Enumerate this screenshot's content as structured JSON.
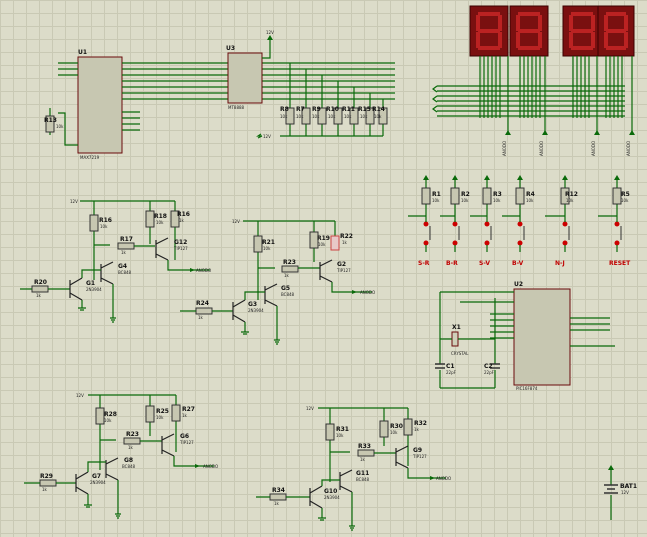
{
  "chips": {
    "u1": {
      "ref": "U1",
      "part": "MAX7219"
    },
    "u3": {
      "ref": "U3",
      "part": "MT8888"
    },
    "u2": {
      "ref": "U2",
      "part": "PIC16F874"
    }
  },
  "transistors": [
    {
      "ref": "G1",
      "part": "2N3904"
    },
    {
      "ref": "G4",
      "part": "BC848"
    },
    {
      "ref": "G12",
      "part": "TIP127"
    },
    {
      "ref": "G3",
      "part": "2N3904"
    },
    {
      "ref": "G5",
      "part": "BC848"
    },
    {
      "ref": "G2",
      "part": "TIP127"
    },
    {
      "ref": "G7",
      "part": "2N3904"
    },
    {
      "ref": "G8",
      "part": "BC848"
    },
    {
      "ref": "G6",
      "part": "TIP127"
    },
    {
      "ref": "G10",
      "part": "2N3904"
    },
    {
      "ref": "G11",
      "part": "BC848"
    },
    {
      "ref": "G9",
      "part": "TIP127"
    }
  ],
  "resistors": {
    "r13": {
      "ref": "R13",
      "val": "10k"
    },
    "row": [
      {
        "ref": "R8",
        "val": "10k"
      },
      {
        "ref": "R7",
        "val": "10k"
      },
      {
        "ref": "R9",
        "val": "10k"
      },
      {
        "ref": "R10",
        "val": "10k"
      },
      {
        "ref": "R11",
        "val": "10k"
      },
      {
        "ref": "R15",
        "val": "10k"
      },
      {
        "ref": "R14",
        "val": "10k"
      }
    ],
    "pullups": [
      {
        "ref": "R1",
        "val": "10k"
      },
      {
        "ref": "R2",
        "val": "10k"
      },
      {
        "ref": "R3",
        "val": "10k"
      },
      {
        "ref": "R4",
        "val": "10k"
      },
      {
        "ref": "R12",
        "val": "10k"
      },
      {
        "ref": "R5",
        "val": "10k"
      }
    ],
    "d1": [
      {
        "ref": "R16",
        "val": "10k"
      },
      {
        "ref": "R18",
        "val": "10k"
      },
      {
        "ref": "R16",
        "val": "1k"
      },
      {
        "ref": "R17",
        "val": "1k"
      },
      {
        "ref": "R20",
        "val": "1k"
      }
    ],
    "d2": [
      {
        "ref": "R21",
        "val": "10k"
      },
      {
        "ref": "R19",
        "val": "10k"
      },
      {
        "ref": "R22",
        "val": "1k"
      },
      {
        "ref": "R23",
        "val": "1k"
      },
      {
        "ref": "R24",
        "val": "1k"
      }
    ],
    "d3": [
      {
        "ref": "R28",
        "val": "10k"
      },
      {
        "ref": "R25",
        "val": "10k"
      },
      {
        "ref": "R27",
        "val": "1k"
      },
      {
        "ref": "R23",
        "val": "1k"
      },
      {
        "ref": "R29",
        "val": "1k"
      }
    ],
    "d4": [
      {
        "ref": "R31",
        "val": "10k"
      },
      {
        "ref": "R30",
        "val": "10k"
      },
      {
        "ref": "R32",
        "val": "1k"
      },
      {
        "ref": "R33",
        "val": "1k"
      },
      {
        "ref": "R34",
        "val": "1k"
      }
    ]
  },
  "buttons": [
    {
      "label": "S-R"
    },
    {
      "label": "B-R"
    },
    {
      "label": "S-V"
    },
    {
      "label": "B-V"
    },
    {
      "label": "N-J"
    },
    {
      "label": "RESET"
    }
  ],
  "crystal": {
    "ref": "X1",
    "val": "CRYSTAL"
  },
  "caps": [
    {
      "ref": "C1",
      "val": "22pF"
    },
    {
      "ref": "C2",
      "val": "22pF"
    }
  ],
  "battery": {
    "ref": "BAT1",
    "val": "12V"
  },
  "power_labels": {
    "v12": "12V"
  },
  "net_labels": {
    "anodo": "ANODO"
  }
}
